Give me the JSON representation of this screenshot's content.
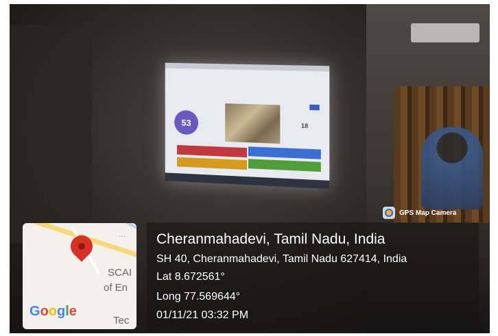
{
  "slide": {
    "timer": "53",
    "answers": "18"
  },
  "gps_camera": {
    "label": "GPS Map Camera",
    "icon": "gps-map-camera-icon"
  },
  "map": {
    "text_1": "SCAI",
    "text_2": "of En",
    "text_3": "Tec",
    "more": "...",
    "google": [
      "G",
      "o",
      "o",
      "g",
      "l",
      "e"
    ]
  },
  "location": {
    "title": "Cheranmahadevi, Tamil Nadu, India",
    "address": "SH 40, Cheranmahadevi, Tamil Nadu 627414, India",
    "latitude": "Lat 8.672561°",
    "longitude": "Long 77.569644°",
    "datetime": "01/11/21 03:32 PM"
  }
}
